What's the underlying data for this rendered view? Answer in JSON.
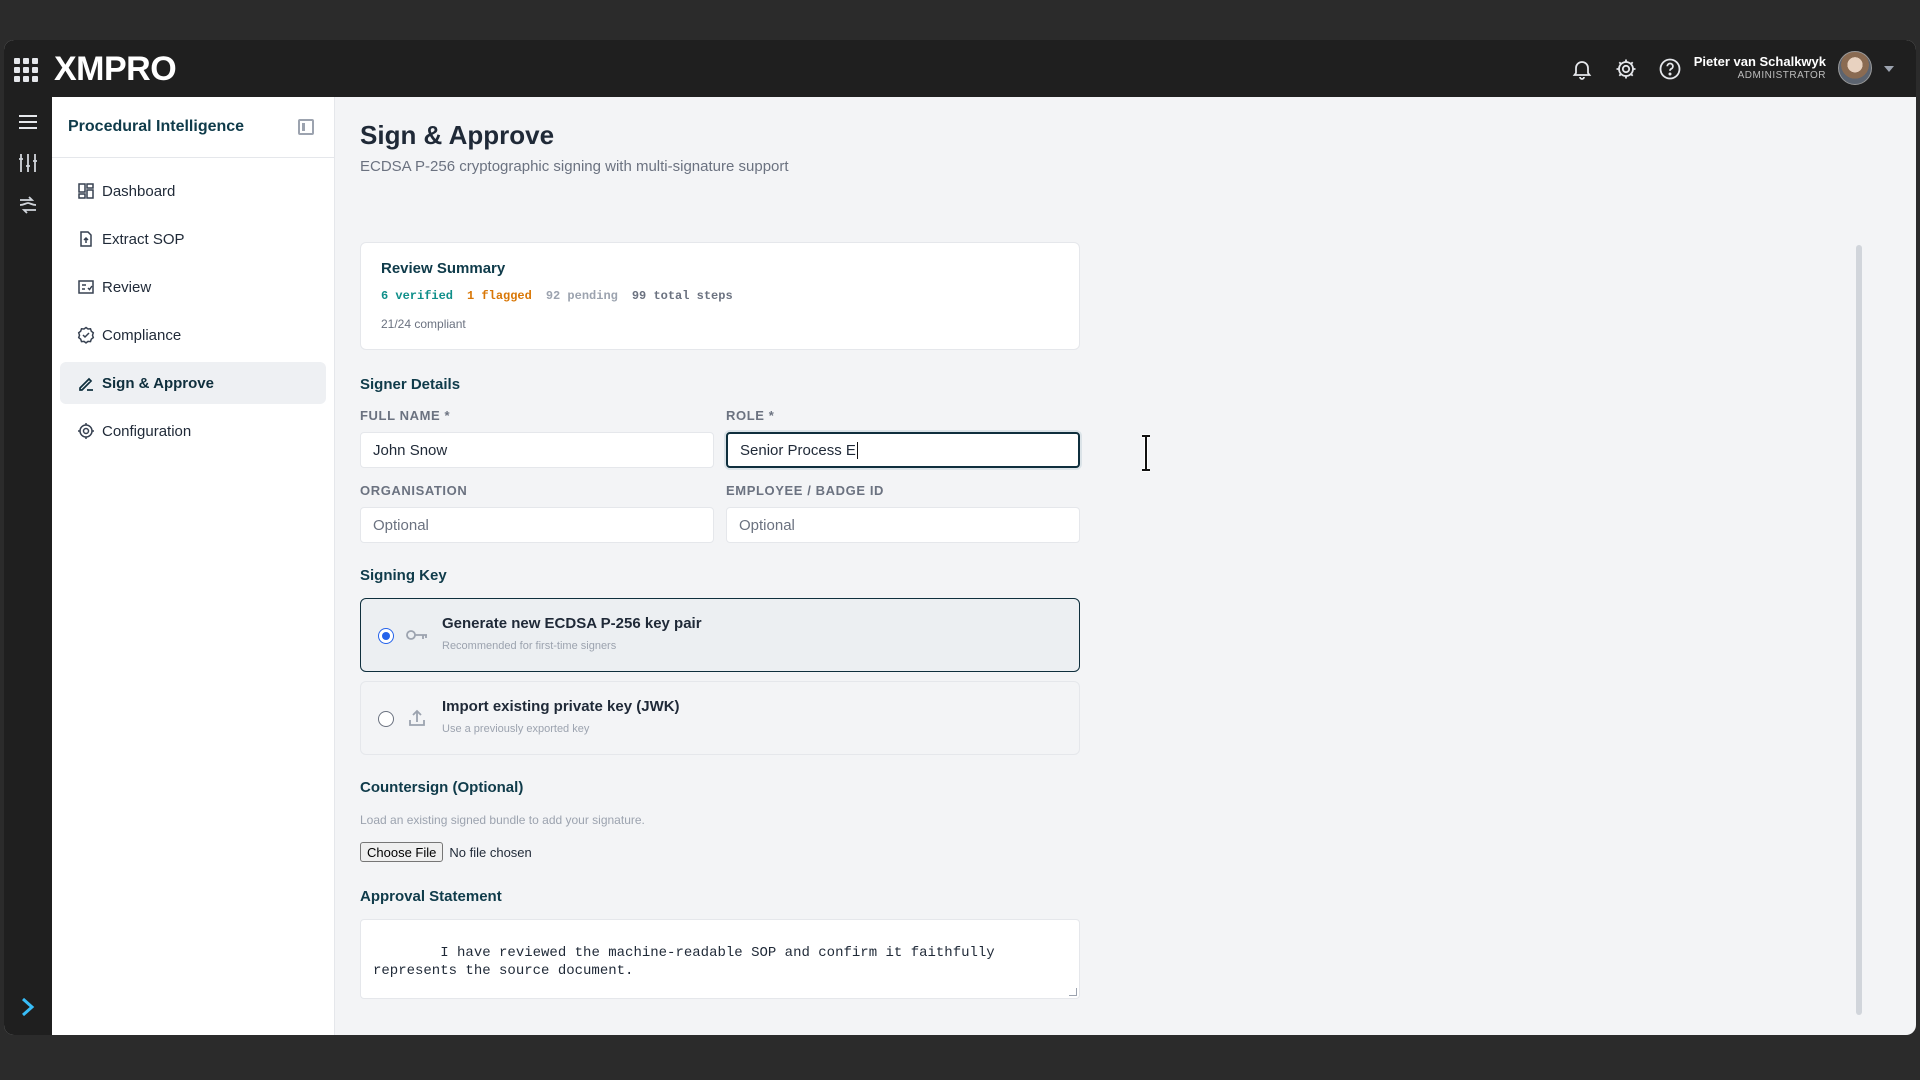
{
  "app": {
    "logo": "XMPRO"
  },
  "user": {
    "name": "Pieter van Schalkwyk",
    "role": "ADMINISTRATOR"
  },
  "sidebar": {
    "title": "Procedural Intelligence",
    "items": [
      {
        "label": "Dashboard",
        "icon": "dashboard-icon",
        "active": false
      },
      {
        "label": "Extract SOP",
        "icon": "file-upload-icon",
        "active": false
      },
      {
        "label": "Review",
        "icon": "review-icon",
        "active": false
      },
      {
        "label": "Compliance",
        "icon": "check-badge-icon",
        "active": false
      },
      {
        "label": "Sign & Approve",
        "icon": "signature-icon",
        "active": true
      },
      {
        "label": "Configuration",
        "icon": "gear-icon",
        "active": false
      }
    ]
  },
  "page": {
    "title": "Sign & Approve",
    "subtitle": "ECDSA P-256 cryptographic signing with multi-signature support"
  },
  "review_summary": {
    "title": "Review Summary",
    "verified": "6 verified",
    "flagged": "1 flagged",
    "pending": "92 pending",
    "total": "99 total steps",
    "compliant": "21/24 compliant"
  },
  "signer": {
    "title": "Signer Details",
    "full_name_label": "FULL NAME *",
    "full_name_value": "John Snow",
    "role_label": "ROLE *",
    "role_value": "Senior Process E",
    "org_label": "ORGANISATION",
    "org_placeholder": "Optional",
    "badge_label": "EMPLOYEE / BADGE ID",
    "badge_placeholder": "Optional"
  },
  "signing_key": {
    "title": "Signing Key",
    "options": [
      {
        "title": "Generate new ECDSA P-256 key pair",
        "subtitle": "Recommended for first-time signers",
        "selected": true,
        "icon": "key-icon"
      },
      {
        "title": "Import existing private key (JWK)",
        "subtitle": "Use a previously exported key",
        "selected": false,
        "icon": "upload-icon"
      }
    ]
  },
  "countersign": {
    "title": "Countersign (Optional)",
    "helper": "Load an existing signed bundle to add your signature.",
    "button": "Choose File",
    "status": "No file chosen"
  },
  "approval": {
    "title": "Approval Statement",
    "text": "I have reviewed the machine-readable SOP and confirm it faithfully\nrepresents the source document."
  },
  "colors": {
    "brand_dark": "#0f2f3d",
    "verified": "#0f8f8a",
    "flagged": "#d97706",
    "radio": "#2563eb"
  }
}
